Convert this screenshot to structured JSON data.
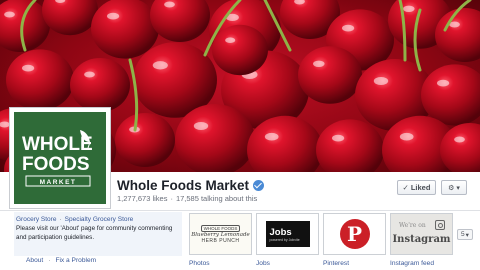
{
  "page": {
    "name": "Whole Foods Market",
    "likes": "1,277,673 likes",
    "separator": "·",
    "talking": "17,585 talking about this"
  },
  "logo": {
    "line1": "WHOLE",
    "line2": "FOODS",
    "line3": "MARKET",
    "brand_color": "#2f6b38"
  },
  "actions": {
    "liked_label": "Liked",
    "check_glyph": "✓",
    "gear_glyph": "⚙",
    "caret_glyph": "▾"
  },
  "about": {
    "category_1": "Grocery Store",
    "category_sep": "·",
    "category_2": "Specialty Grocery Store",
    "text": "Please visit our 'About' page for community commenting and participation guidelines.",
    "link_about": "About",
    "link_sep": "·",
    "link_report": "Fix a Problem"
  },
  "apps": [
    {
      "label": "Photos",
      "thumb_top": "WHOLE FOODS",
      "thumb_mid": "Blueberry Lemonade",
      "thumb_bot": "HERB PUNCH"
    },
    {
      "label": "Jobs",
      "thumb_title": "Jobs",
      "thumb_sub": "powered by Jobvite"
    },
    {
      "label": "Pinterest",
      "thumb_glyph": "P"
    },
    {
      "label": "Instagram feed",
      "thumb_top": "We're on",
      "thumb_name": "Instagram"
    }
  ],
  "more": {
    "count": "5",
    "caret": "▾"
  },
  "colors": {
    "link": "#3b5998",
    "cherry": "#b3091d",
    "stem": "#8fb247",
    "pinterest": "#cb2027"
  }
}
